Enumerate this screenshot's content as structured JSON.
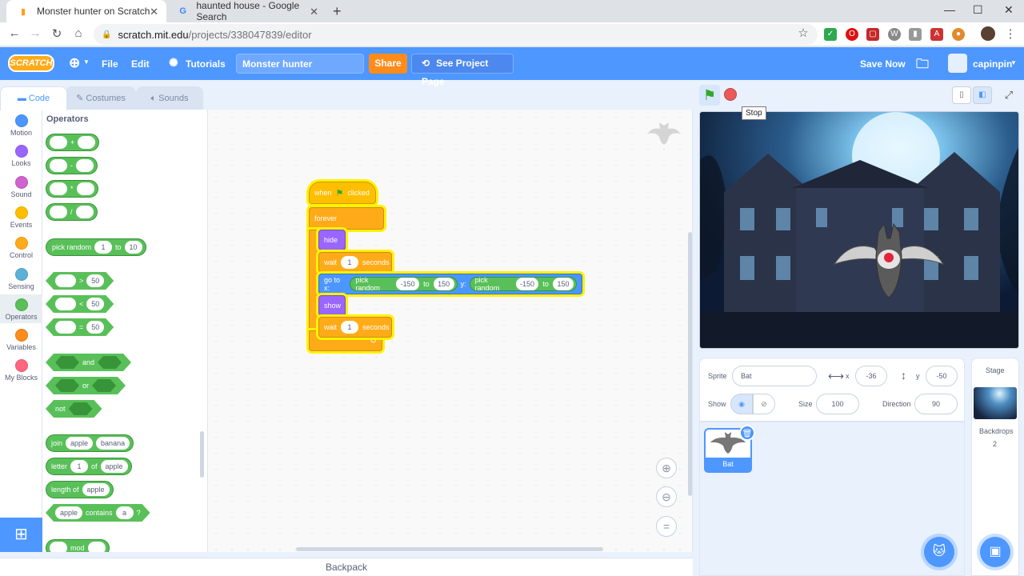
{
  "browser": {
    "tabs": [
      {
        "title": "Monster hunter on Scratch",
        "icon": "scratch-cat-icon",
        "active": true
      },
      {
        "title": "haunted house - Google Search",
        "icon": "google-icon",
        "active": false
      }
    ],
    "url_host": "scratch.mit.edu",
    "url_path": "/projects/338047839/editor"
  },
  "menubar": {
    "logo": "SCRATCH",
    "file": "File",
    "edit": "Edit",
    "tutorials": "Tutorials",
    "project_title": "Monster hunter",
    "share": "Share",
    "see_project_page": "See Project Page",
    "save_now": "Save Now",
    "username": "capinpin"
  },
  "editor_tabs": {
    "code": "Code",
    "costumes": "Costumes",
    "sounds": "Sounds"
  },
  "categories": [
    {
      "label": "Motion",
      "color": "#4c97ff"
    },
    {
      "label": "Looks",
      "color": "#9966ff"
    },
    {
      "label": "Sound",
      "color": "#cf63cf"
    },
    {
      "label": "Events",
      "color": "#ffbf00"
    },
    {
      "label": "Control",
      "color": "#ffab19"
    },
    {
      "label": "Sensing",
      "color": "#5cb1d6"
    },
    {
      "label": "Operators",
      "color": "#59c059"
    },
    {
      "label": "Variables",
      "color": "#ff8c1a"
    },
    {
      "label": "My Blocks",
      "color": "#ff6680"
    }
  ],
  "palette": {
    "title": "Operators",
    "plus": "+",
    "minus": "-",
    "times": "*",
    "divide": "/",
    "pick_random": "pick random",
    "pr_from": "1",
    "to": "to",
    "pr_to": "10",
    "gt": ">",
    "lt": "<",
    "eq": "=",
    "cmp_val": "50",
    "and": "and",
    "or": "or",
    "not": "not",
    "join": "join",
    "apple": "apple",
    "banana": "banana",
    "letter": "letter",
    "letter_n": "1",
    "of": "of",
    "length_of": "length of",
    "contains": "contains",
    "contains_val": "a",
    "question": "?",
    "mod": "mod"
  },
  "script": {
    "when": "when",
    "clicked": "clicked",
    "forever": "forever",
    "hide": "hide",
    "wait": "wait",
    "wait_val": "1",
    "seconds": "seconds",
    "go_to_x": "go to x:",
    "y": "y:",
    "pick_random": "pick random",
    "rand_from": "-150",
    "to": "to",
    "rand_to": "150",
    "show": "show"
  },
  "stage": {
    "tooltip": "Stop"
  },
  "sprite_info": {
    "sprite_label": "Sprite",
    "sprite_name": "Bat",
    "x_label": "x",
    "x_value": "-36",
    "y_label": "y",
    "y_value": "-50",
    "show_label": "Show",
    "size_label": "Size",
    "size_value": "100",
    "direction_label": "Direction",
    "direction_value": "90"
  },
  "sprites": [
    {
      "name": "Bat"
    }
  ],
  "stage_pane": {
    "title": "Stage",
    "backdrops_label": "Backdrops",
    "backdrops_count": "2"
  },
  "backpack": "Backpack"
}
